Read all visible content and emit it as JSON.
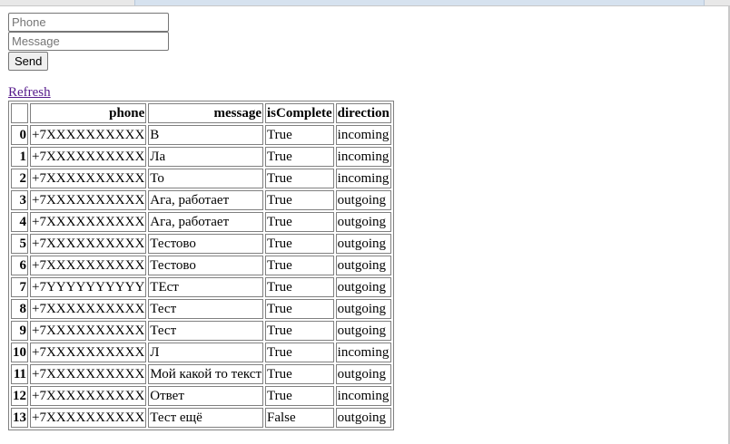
{
  "form": {
    "phone_placeholder": "Phone",
    "message_placeholder": "Message",
    "send_label": "Send"
  },
  "refresh_label": "Refresh",
  "table": {
    "headers": [
      "",
      "phone",
      "message",
      "isComplete",
      "direction"
    ],
    "rows": [
      {
        "index": "0",
        "phone": "+7XXXXXXXXXX",
        "message": "В",
        "isComplete": "True",
        "direction": "incoming"
      },
      {
        "index": "1",
        "phone": "+7XXXXXXXXXX",
        "message": "Ла",
        "isComplete": "True",
        "direction": "incoming"
      },
      {
        "index": "2",
        "phone": "+7XXXXXXXXXX",
        "message": "То",
        "isComplete": "True",
        "direction": "incoming"
      },
      {
        "index": "3",
        "phone": "+7XXXXXXXXXX",
        "message": "Ага, работает",
        "isComplete": "True",
        "direction": "outgoing"
      },
      {
        "index": "4",
        "phone": "+7XXXXXXXXXX",
        "message": "Ага, работает",
        "isComplete": "True",
        "direction": "outgoing"
      },
      {
        "index": "5",
        "phone": "+7XXXXXXXXXX",
        "message": "Тестово",
        "isComplete": "True",
        "direction": "outgoing"
      },
      {
        "index": "6",
        "phone": "+7XXXXXXXXXX",
        "message": "Тестово",
        "isComplete": "True",
        "direction": "outgoing"
      },
      {
        "index": "7",
        "phone": "+7YYYYYYYYYY",
        "message": "ТЕст",
        "isComplete": "True",
        "direction": "outgoing"
      },
      {
        "index": "8",
        "phone": "+7XXXXXXXXXX",
        "message": "Тест",
        "isComplete": "True",
        "direction": "outgoing"
      },
      {
        "index": "9",
        "phone": "+7XXXXXXXXXX",
        "message": "Тест",
        "isComplete": "True",
        "direction": "outgoing"
      },
      {
        "index": "10",
        "phone": "+7XXXXXXXXXX",
        "message": "Л",
        "isComplete": "True",
        "direction": "incoming"
      },
      {
        "index": "11",
        "phone": "+7XXXXXXXXXX",
        "message": "Мой какой то текст",
        "isComplete": "True",
        "direction": "outgoing"
      },
      {
        "index": "12",
        "phone": "+7XXXXXXXXXX",
        "message": "Ответ",
        "isComplete": "True",
        "direction": "incoming"
      },
      {
        "index": "13",
        "phone": "+7XXXXXXXXXX",
        "message": "Тест ещё",
        "isComplete": "False",
        "direction": "outgoing"
      }
    ]
  }
}
